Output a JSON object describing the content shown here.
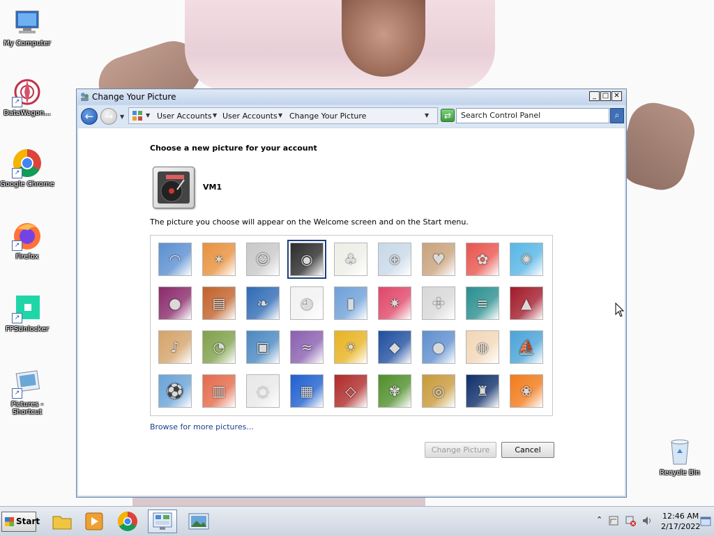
{
  "window": {
    "title": "Change Your Picture",
    "buttons": {
      "minimize": "_",
      "maximize": "□",
      "close": "✕"
    }
  },
  "address_bar": {
    "crumbs": [
      "User Accounts",
      "User Accounts",
      "Change Your Picture"
    ],
    "search_placeholder": "Search Control Panel"
  },
  "main": {
    "heading": "Choose a new picture for your account",
    "username": "VM1",
    "description": "The picture you choose will appear on the Welcome screen and on the Start menu.",
    "browse_link": "Browse for more pictures...",
    "change_button": "Change Picture",
    "cancel_button": "Cancel",
    "pictures": [
      {
        "name": "roller-coaster",
        "color": "#5b8fd1",
        "glyph": "◠"
      },
      {
        "name": "starfish",
        "color": "#e8913c",
        "glyph": "✶"
      },
      {
        "name": "robot",
        "color": "#c8c8c8",
        "glyph": "☺"
      },
      {
        "name": "record-player",
        "color": "#2b2b2b",
        "glyph": "◉",
        "selected": true
      },
      {
        "name": "lucky-cat",
        "color": "#eeeee8",
        "glyph": "♣"
      },
      {
        "name": "gyroscope",
        "color": "#c8d8e8",
        "glyph": "⊕"
      },
      {
        "name": "kitten",
        "color": "#c9a27c",
        "glyph": "♥"
      },
      {
        "name": "flower",
        "color": "#e8554e",
        "glyph": "✿"
      },
      {
        "name": "pinwheel",
        "color": "#57b6e6",
        "glyph": "✺"
      },
      {
        "name": "ball",
        "color": "#8a2a6b",
        "glyph": "●"
      },
      {
        "name": "fabric",
        "color": "#c2622a",
        "glyph": "▤"
      },
      {
        "name": "leaf",
        "color": "#2f6bb5",
        "glyph": "❧"
      },
      {
        "name": "dog",
        "color": "#f2f2f2",
        "glyph": "◕"
      },
      {
        "name": "crayons",
        "color": "#6fa0d8",
        "glyph": "▮"
      },
      {
        "name": "paper-star",
        "color": "#e04668",
        "glyph": "✷"
      },
      {
        "name": "jacks",
        "color": "#d8d8d8",
        "glyph": "✣"
      },
      {
        "name": "stairs",
        "color": "#2a8f8f",
        "glyph": "≡"
      },
      {
        "name": "origami-crane",
        "color": "#a21a2a",
        "glyph": "▲"
      },
      {
        "name": "guitar",
        "color": "#d4a36a",
        "glyph": "♪"
      },
      {
        "name": "pomeranian",
        "color": "#7fa14a",
        "glyph": "◔"
      },
      {
        "name": "toy-robot",
        "color": "#4a88c2",
        "glyph": "▣"
      },
      {
        "name": "scarf",
        "color": "#8a5fb0",
        "glyph": "≈"
      },
      {
        "name": "sunflower",
        "color": "#e8b320",
        "glyph": "☀"
      },
      {
        "name": "fish",
        "color": "#1f4f9f",
        "glyph": "◆"
      },
      {
        "name": "hot-air-balloon",
        "color": "#5f8fcf",
        "glyph": "●"
      },
      {
        "name": "doll",
        "color": "#f2d7b7",
        "glyph": "◍"
      },
      {
        "name": "sailboat",
        "color": "#4aa3d8",
        "glyph": "⛵"
      },
      {
        "name": "soccer-ball",
        "color": "#6aa3d8",
        "glyph": "⚽"
      },
      {
        "name": "textile",
        "color": "#e46a4a",
        "glyph": "▥"
      },
      {
        "name": "marbles",
        "color": "#e8e8e8",
        "glyph": "◌"
      },
      {
        "name": "window",
        "color": "#1e5fcf",
        "glyph": "▦"
      },
      {
        "name": "pattern",
        "color": "#b02a2a",
        "glyph": "◇"
      },
      {
        "name": "butterfly",
        "color": "#4f8f2a",
        "glyph": "✾"
      },
      {
        "name": "spiral",
        "color": "#c89a3a",
        "glyph": "◎"
      },
      {
        "name": "lighthouse",
        "color": "#0f2f6a",
        "glyph": "♜"
      },
      {
        "name": "gerbera",
        "color": "#f27a1a",
        "glyph": "❀"
      }
    ]
  },
  "desktop": {
    "icons": [
      "My Computer",
      "DataWagon...",
      "Google Chrome",
      "Firefox",
      "FPSUnlocker",
      "Pictures - Shortcut",
      "Recycle Bin"
    ]
  },
  "taskbar": {
    "start_label": "Start",
    "time": "12:46 AM",
    "date": "2/17/2022"
  }
}
